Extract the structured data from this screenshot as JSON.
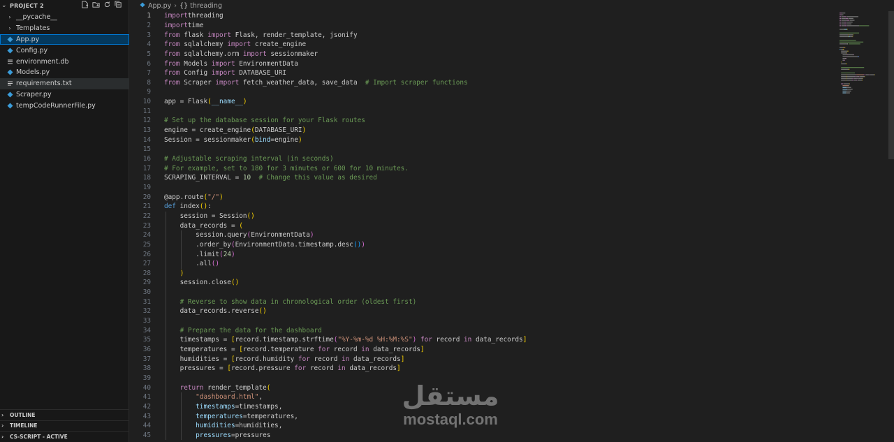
{
  "explorer": {
    "project_title": "PROJECT 2",
    "items": [
      {
        "label": "__pycache__",
        "kind": "folder"
      },
      {
        "label": "Templates",
        "kind": "folder"
      },
      {
        "label": "App.py",
        "kind": "python",
        "selected": true
      },
      {
        "label": "Config.py",
        "kind": "python"
      },
      {
        "label": "environment.db",
        "kind": "db"
      },
      {
        "label": "Models.py",
        "kind": "python"
      },
      {
        "label": "requirements.txt",
        "kind": "text",
        "hover": true
      },
      {
        "label": "Scraper.py",
        "kind": "python"
      },
      {
        "label": "tempCodeRunnerFile.py",
        "kind": "python"
      }
    ],
    "panels": [
      "OUTLINE",
      "TIMELINE",
      "CS-SCRIPT - ACTIVE"
    ]
  },
  "breadcrumb": {
    "file": "App.py",
    "symbol": "threading"
  },
  "editor": {
    "active_line": 1,
    "lines": [
      [
        [
          "kw",
          "import"
        ],
        [
          "",
          "threading"
        ]
      ],
      [
        [
          "kw",
          "import"
        ],
        [
          "",
          "time"
        ]
      ],
      [
        [
          "kw",
          "from"
        ],
        [
          "",
          " flask "
        ],
        [
          "kw",
          "import"
        ],
        [
          "",
          " Flask, render_template, jsonify"
        ]
      ],
      [
        [
          "kw",
          "from"
        ],
        [
          "",
          " sqlalchemy "
        ],
        [
          "kw",
          "import"
        ],
        [
          "",
          " create_engine"
        ]
      ],
      [
        [
          "kw",
          "from"
        ],
        [
          "",
          " sqlalchemy.orm "
        ],
        [
          "kw",
          "import"
        ],
        [
          "",
          " sessionmaker"
        ]
      ],
      [
        [
          "kw",
          "from"
        ],
        [
          "",
          " Models "
        ],
        [
          "kw",
          "import"
        ],
        [
          "",
          " EnvironmentData"
        ]
      ],
      [
        [
          "kw",
          "from"
        ],
        [
          "",
          " Config "
        ],
        [
          "kw",
          "import"
        ],
        [
          "",
          " DATABASE_URI"
        ]
      ],
      [
        [
          "kw",
          "from"
        ],
        [
          "",
          " Scraper "
        ],
        [
          "kw",
          "import"
        ],
        [
          "",
          " fetch_weather_data, save_data  "
        ],
        [
          "cmt",
          "# Import scraper functions"
        ]
      ],
      [],
      [
        [
          "",
          "app = Flask"
        ],
        [
          "br1",
          "("
        ],
        [
          "var",
          "__name__"
        ],
        [
          "br1",
          ")"
        ]
      ],
      [],
      [
        [
          "cmt",
          "# Set up the database session for your Flask routes"
        ]
      ],
      [
        [
          "",
          "engine = create_engine"
        ],
        [
          "br1",
          "("
        ],
        [
          "",
          "DATABASE_URI"
        ],
        [
          "br1",
          ")"
        ]
      ],
      [
        [
          "",
          "Session = sessionmaker"
        ],
        [
          "br1",
          "("
        ],
        [
          "var",
          "bind"
        ],
        [
          "",
          "=engine"
        ],
        [
          "br1",
          ")"
        ]
      ],
      [],
      [
        [
          "cmt",
          "# Adjustable scraping interval (in seconds)"
        ]
      ],
      [
        [
          "cmt",
          "# For example, set to 180 for 3 minutes or 600 for 10 minutes."
        ]
      ],
      [
        [
          "",
          "SCRAPING_INTERVAL = "
        ],
        [
          "num",
          "10"
        ],
        [
          "",
          "  "
        ],
        [
          "cmt",
          "# Change this value as desired"
        ]
      ],
      [],
      [
        [
          "",
          "@app.route"
        ],
        [
          "br1",
          "("
        ],
        [
          "str",
          "\"/\""
        ],
        [
          "br1",
          ")"
        ]
      ],
      [
        [
          "kwb",
          "def"
        ],
        [
          "",
          " index"
        ],
        [
          "br1",
          "()"
        ],
        [
          "",
          ":"
        ]
      ],
      [
        [
          "",
          "    session = Session"
        ],
        [
          "br1",
          "()"
        ]
      ],
      [
        [
          "",
          "    data_records = "
        ],
        [
          "br1",
          "("
        ]
      ],
      [
        [
          "",
          "        session.query"
        ],
        [
          "br2",
          "("
        ],
        [
          "",
          "EnvironmentData"
        ],
        [
          "br2",
          ")"
        ]
      ],
      [
        [
          "",
          "        .order_by"
        ],
        [
          "br2",
          "("
        ],
        [
          "",
          "EnvironmentData.timestamp.desc"
        ],
        [
          "br3",
          "()"
        ],
        [
          "br2",
          ")"
        ]
      ],
      [
        [
          "",
          "        .limit"
        ],
        [
          "br2",
          "("
        ],
        [
          "num",
          "24"
        ],
        [
          "br2",
          ")"
        ]
      ],
      [
        [
          "",
          "        .all"
        ],
        [
          "br2",
          "()"
        ]
      ],
      [
        [
          "br1",
          "    )"
        ]
      ],
      [
        [
          "",
          "    session.close"
        ],
        [
          "br1",
          "()"
        ]
      ],
      [],
      [
        [
          "cmt",
          "    # Reverse to show data in chronological order (oldest first)"
        ]
      ],
      [
        [
          "",
          "    data_records.reverse"
        ],
        [
          "br1",
          "()"
        ]
      ],
      [],
      [
        [
          "cmt",
          "    # Prepare the data for the dashboard"
        ]
      ],
      [
        [
          "",
          "    timestamps = "
        ],
        [
          "br1",
          "["
        ],
        [
          "",
          "record.timestamp.strftime"
        ],
        [
          "br2",
          "("
        ],
        [
          "str",
          "\"%Y-%m-%d %H:%M:%S\""
        ],
        [
          "br2",
          ")"
        ],
        [
          "",
          " "
        ],
        [
          "kw",
          "for"
        ],
        [
          "",
          " record "
        ],
        [
          "kw",
          "in"
        ],
        [
          "",
          " data_records"
        ],
        [
          "br1",
          "]"
        ]
      ],
      [
        [
          "",
          "    temperatures = "
        ],
        [
          "br1",
          "["
        ],
        [
          "",
          "record.temperature "
        ],
        [
          "kw",
          "for"
        ],
        [
          "",
          " record "
        ],
        [
          "kw",
          "in"
        ],
        [
          "",
          " data_records"
        ],
        [
          "br1",
          "]"
        ]
      ],
      [
        [
          "",
          "    humidities = "
        ],
        [
          "br1",
          "["
        ],
        [
          "",
          "record.humidity "
        ],
        [
          "kw",
          "for"
        ],
        [
          "",
          " record "
        ],
        [
          "kw",
          "in"
        ],
        [
          "",
          " data_records"
        ],
        [
          "br1",
          "]"
        ]
      ],
      [
        [
          "",
          "    pressures = "
        ],
        [
          "br1",
          "["
        ],
        [
          "",
          "record.pressure "
        ],
        [
          "kw",
          "for"
        ],
        [
          "",
          " record "
        ],
        [
          "kw",
          "in"
        ],
        [
          "",
          " data_records"
        ],
        [
          "br1",
          "]"
        ]
      ],
      [],
      [
        [
          "",
          "    "
        ],
        [
          "kw",
          "return"
        ],
        [
          "",
          " render_template"
        ],
        [
          "br1",
          "("
        ]
      ],
      [
        [
          "",
          "        "
        ],
        [
          "str",
          "\"dashboard.html\""
        ],
        [
          "",
          ","
        ]
      ],
      [
        [
          "",
          "        "
        ],
        [
          "var",
          "timestamps"
        ],
        [
          "",
          "=timestamps,"
        ]
      ],
      [
        [
          "",
          "        "
        ],
        [
          "var",
          "temperatures"
        ],
        [
          "",
          "=temperatures,"
        ]
      ],
      [
        [
          "",
          "        "
        ],
        [
          "var",
          "humidities"
        ],
        [
          "",
          "=humidities,"
        ]
      ],
      [
        [
          "",
          "        "
        ],
        [
          "var",
          "pressures"
        ],
        [
          "",
          "=pressures"
        ]
      ]
    ]
  },
  "watermark": {
    "arabic": "مستقل",
    "latin": "mostaql.com"
  }
}
